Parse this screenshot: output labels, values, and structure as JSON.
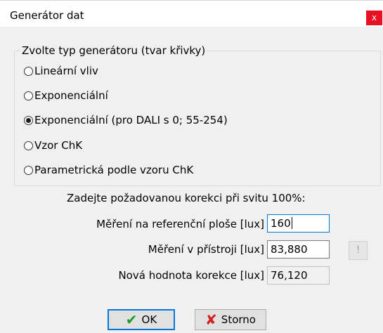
{
  "window": {
    "title": "Generátor dat",
    "close_label": "x"
  },
  "group": {
    "legend": "Zvolte typ generátoru (tvar křivky)",
    "options": [
      {
        "label": "Lineární vliv",
        "selected": false
      },
      {
        "label": "Exponenciální",
        "selected": false
      },
      {
        "label": "Exponenciální (pro DALI s 0; 55-254)",
        "selected": true
      },
      {
        "label": "Vzor ChK",
        "selected": false
      },
      {
        "label": "Parametrická podle vzoru ChK",
        "selected": false
      }
    ]
  },
  "correction": {
    "prompt": "Zadejte požadovanou korekci při svitu 100%:",
    "reference_label": "Měření na referenční ploše [lux]",
    "reference_value": "160",
    "device_label": "Měření v přístroji [lux]",
    "device_value": "83,880",
    "device_button": "!",
    "new_label": "Nová hodnota korekce [lux]",
    "new_value": "76,120"
  },
  "buttons": {
    "ok": "OK",
    "cancel": "Storno"
  },
  "colors": {
    "close_bg": "#e81123",
    "focus_border": "#0078d7",
    "ok_check": "#1f9a2a",
    "cancel_x": "#d42020"
  },
  "icons": {
    "ok": "check-icon",
    "cancel": "x-icon",
    "close": "close-icon"
  }
}
